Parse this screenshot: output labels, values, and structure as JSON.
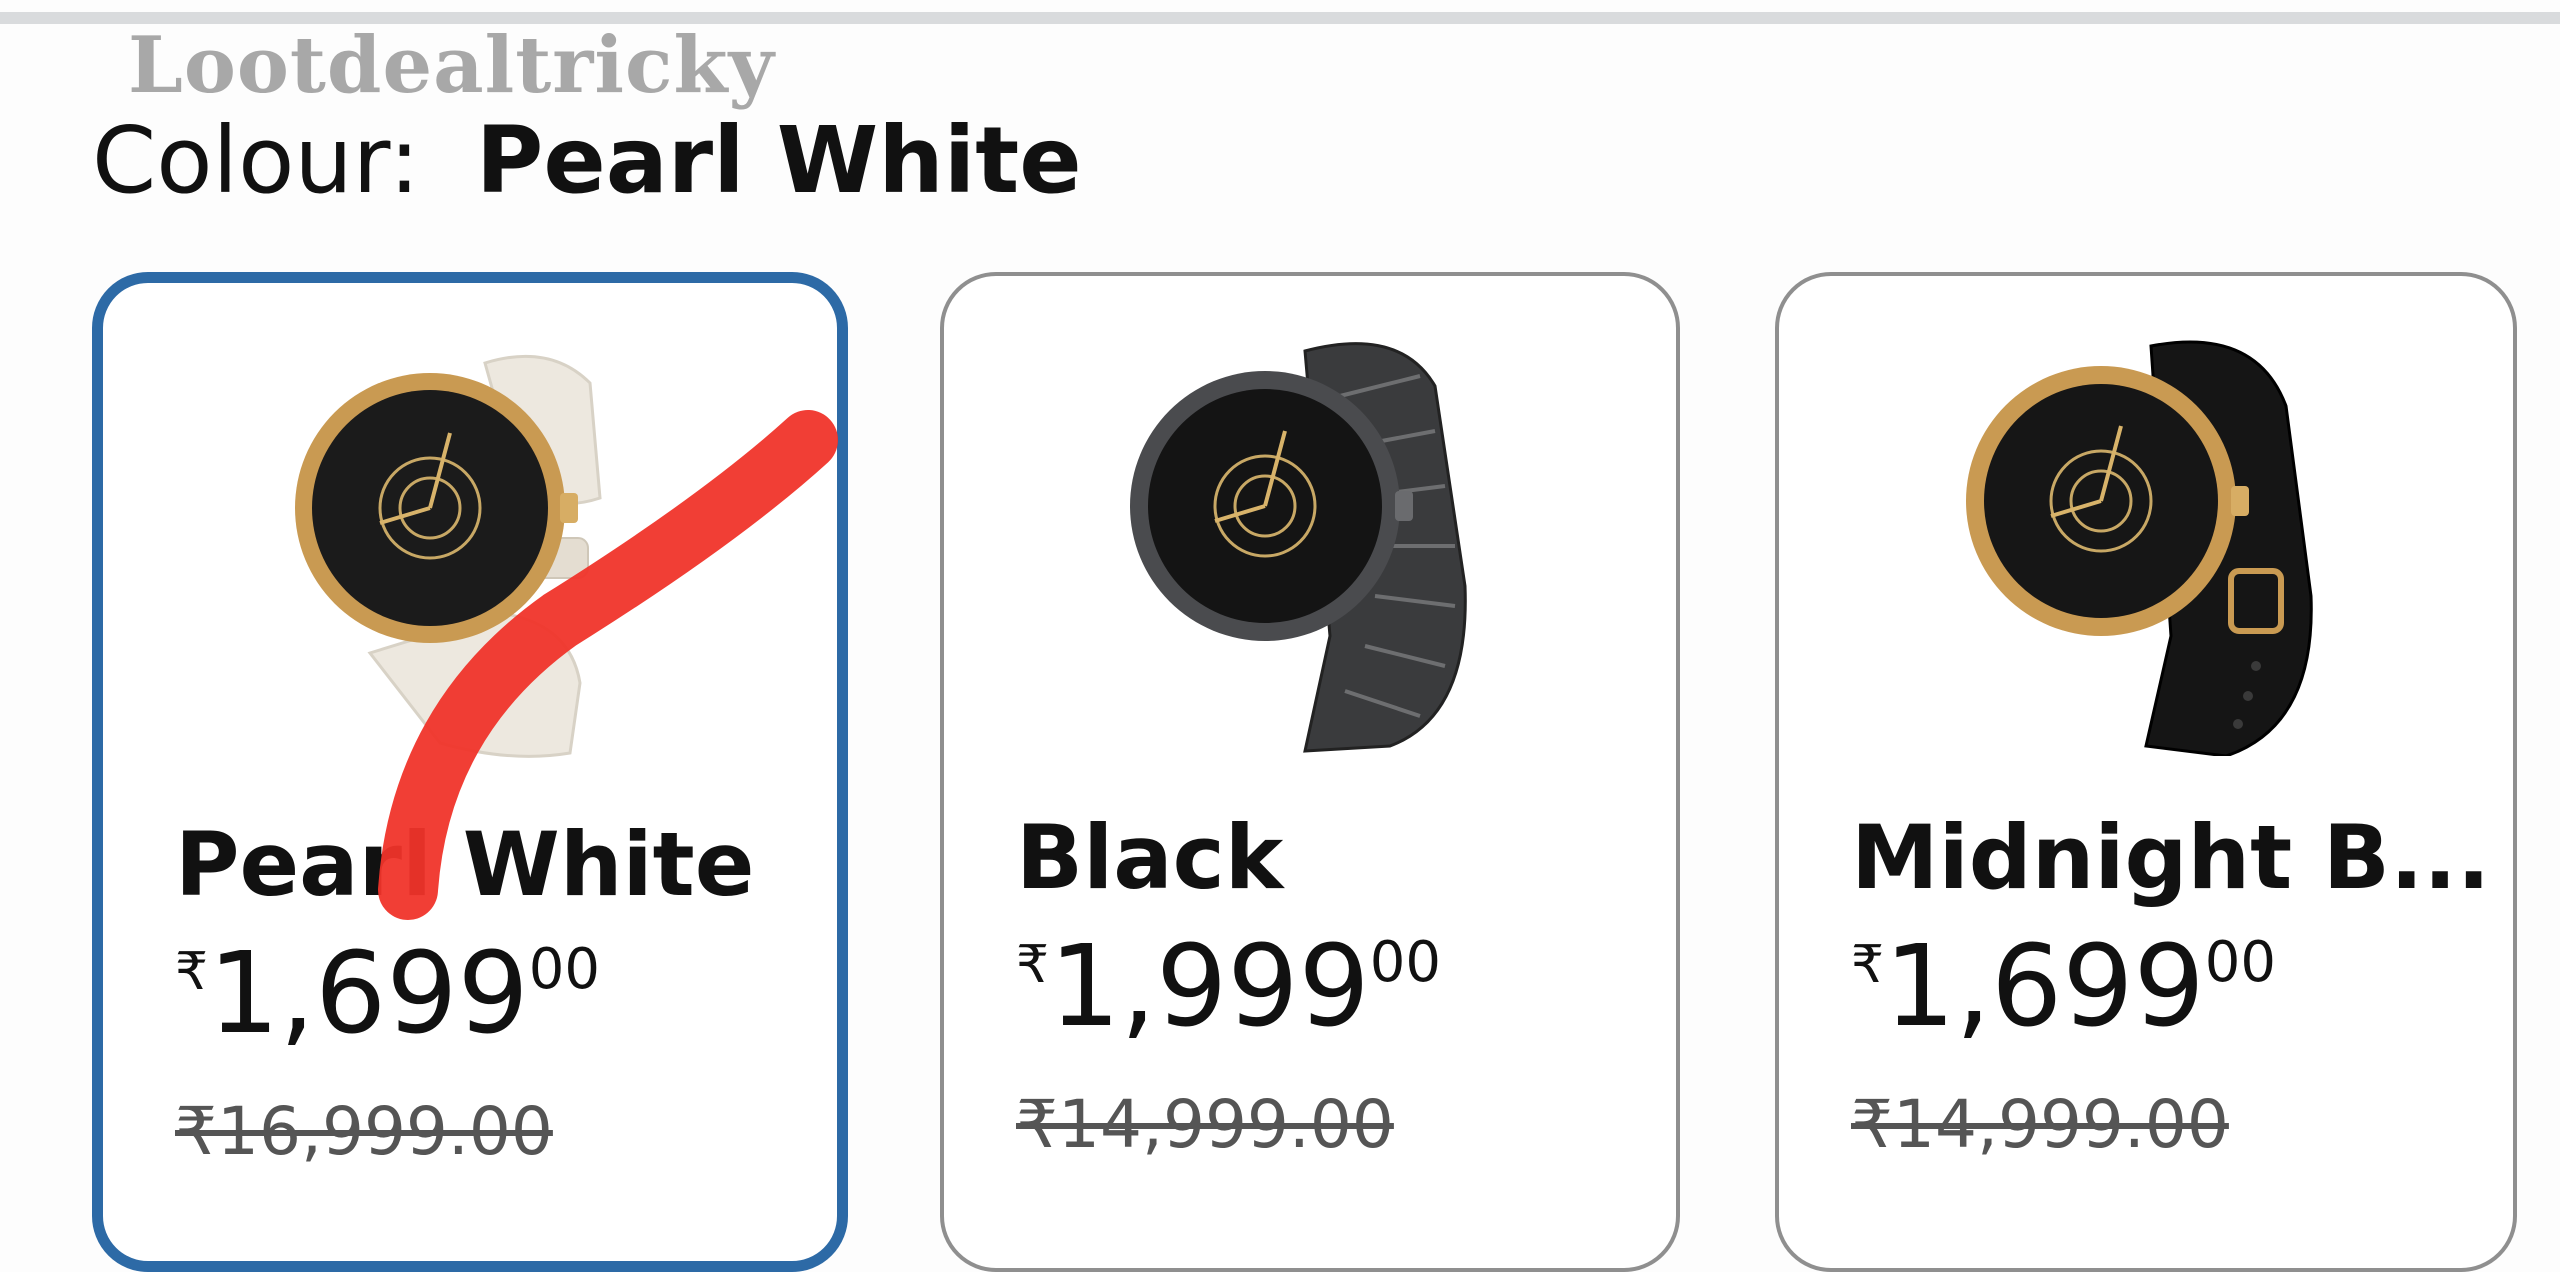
{
  "watermark": "Lootdealtricky",
  "colour": {
    "label": "Colour:",
    "selected": "Pearl White"
  },
  "options": [
    {
      "name": "Pearl White",
      "price_symbol": "₹",
      "price_whole": "1,699",
      "price_fraction": "00",
      "mrp": "₹16,999.00",
      "selected": true,
      "strap": "pearl-white-strap",
      "colors": {
        "strap": "#ede8df",
        "case": "#c99a52",
        "dial": "#1a1a1a"
      }
    },
    {
      "name": "Black",
      "price_symbol": "₹",
      "price_whole": "1,999",
      "price_fraction": "00",
      "mrp": "₹14,999.00",
      "selected": false,
      "strap": "metal-link-bracelet",
      "colors": {
        "strap": "#3a3b3d",
        "case": "#4a4b4e",
        "dial": "#1a1a1a"
      }
    },
    {
      "name": "Midnight B...",
      "price_symbol": "₹",
      "price_whole": "1,699",
      "price_fraction": "00",
      "mrp": "₹14,999.00",
      "selected": false,
      "strap": "black-silicone-strap",
      "colors": {
        "strap": "#151515",
        "case": "#c99a52",
        "dial": "#1a1a1a"
      }
    }
  ],
  "theme": {
    "selected_border": "#2d6aa6",
    "unselected_border": "#8f8f8f",
    "annotation_mark": "#f0342a"
  }
}
